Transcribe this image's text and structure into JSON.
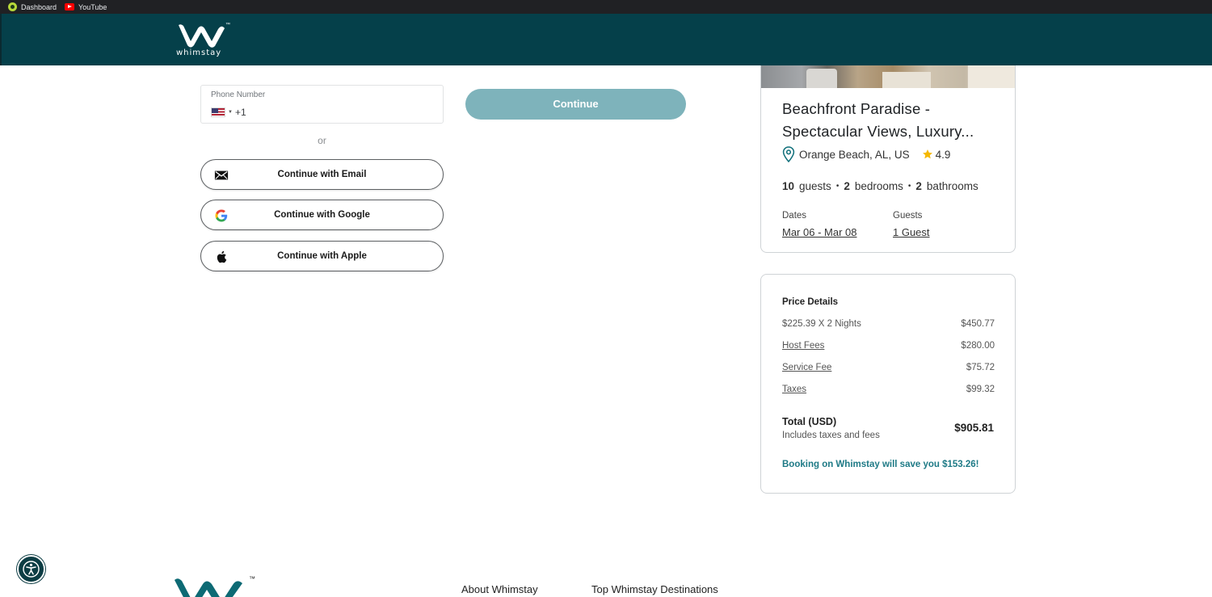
{
  "bookmarks": [
    {
      "label": "Dashboard",
      "icon": "green-circle-icon"
    },
    {
      "label": "YouTube",
      "icon": "youtube-icon"
    }
  ],
  "header": {
    "logo_text": "whimstay",
    "logo_tm": "™",
    "background": "#05404a"
  },
  "auth": {
    "phone_label": "Phone Number",
    "country_code": "+1",
    "country_flag": "us-flag-icon",
    "continue_label": "Continue",
    "or_label": "or",
    "email_label": "Continue with Email",
    "google_label": "Continue with Google",
    "apple_label": "Continue with Apple"
  },
  "listing": {
    "title": "Beachfront Paradise - Spectacular Views, Luxury...",
    "location": "Orange Beach, AL, US",
    "rating": "4.9",
    "guests_count": "10",
    "guests_unit": "guests",
    "bedrooms_count": "2",
    "bedrooms_unit": "bedrooms",
    "bathrooms_count": "2",
    "bathrooms_unit": "bathrooms",
    "dates_label": "Dates",
    "dates_value": "Mar 06 - Mar 08",
    "guests_label": "Guests",
    "guests_value": "1 Guest"
  },
  "price": {
    "title": "Price Details",
    "rows": [
      {
        "label": "$225.39 X 2 Nights",
        "value": "$450.77"
      },
      {
        "label": "Host Fees",
        "value": "$280.00"
      },
      {
        "label": "Service Fee",
        "value": "$75.72"
      },
      {
        "label": "Taxes",
        "value": "$99.32"
      }
    ],
    "total_label": "Total (USD)",
    "total_sub": "Includes taxes and fees",
    "total_value": "$905.81",
    "savings": "Booking on Whimstay will save you $153.26!",
    "accent": "#1e7a86"
  },
  "footer": {
    "logo_tm": "™",
    "about": "About Whimstay",
    "destinations": "Top Whimstay Destinations"
  },
  "colors": {
    "continue_button": "#7eb3bb",
    "a11y_button": "#0d3d44"
  }
}
